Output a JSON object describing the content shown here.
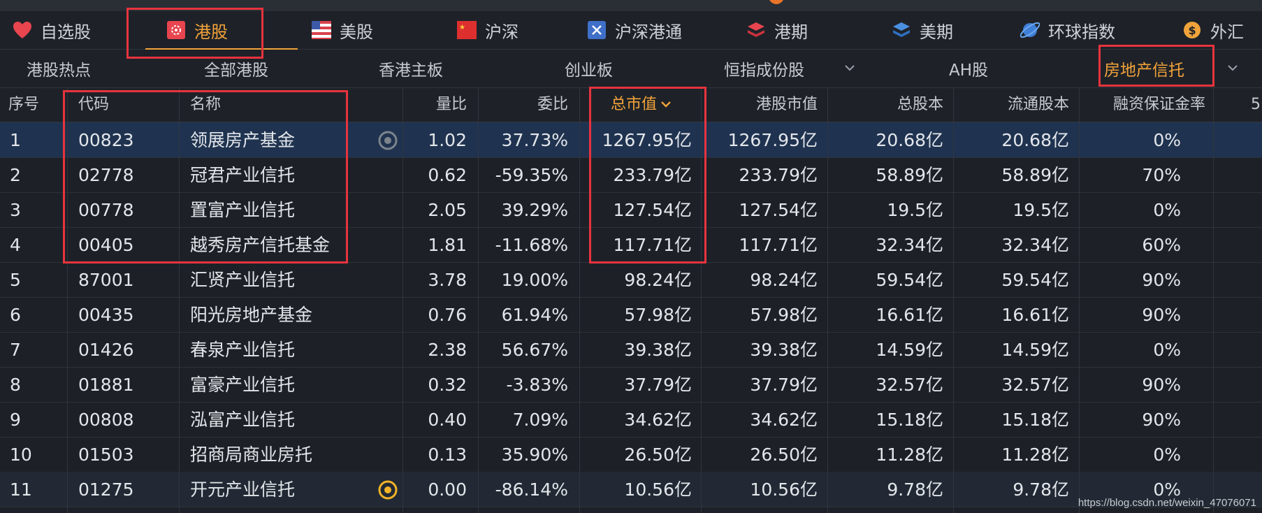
{
  "market_tabs": [
    {
      "label": "自选股",
      "icon": "heart-icon"
    },
    {
      "label": "港股",
      "icon": "hk-flag-icon",
      "active": true
    },
    {
      "label": "美股",
      "icon": "us-flag-icon"
    },
    {
      "label": "沪深",
      "icon": "cn-flag-icon"
    },
    {
      "label": "沪深港通",
      "icon": "connect-icon"
    },
    {
      "label": "港期",
      "icon": "stack-red-icon"
    },
    {
      "label": "美期",
      "icon": "stack-blue-icon"
    },
    {
      "label": "环球指数",
      "icon": "globe-icon"
    },
    {
      "label": "外汇",
      "icon": "dollar-coin-icon"
    }
  ],
  "sub_tabs": [
    {
      "label": "港股热点"
    },
    {
      "label": "全部港股"
    },
    {
      "label": "香港主板"
    },
    {
      "label": "创业板"
    },
    {
      "label": "恒指成份股"
    },
    {
      "label": "AH股"
    },
    {
      "label": "房地产信托",
      "active": true
    }
  ],
  "columns": {
    "seq": "序号",
    "code": "代码",
    "name": "名称",
    "vol_ratio": "量比",
    "bid_ratio": "委比",
    "total_mcap": "总市值",
    "hk_mcap": "港股市值",
    "total_shares": "总股本",
    "float_shares": "流通股本",
    "margin_rate": "融资保证金率",
    "next_partial": "5"
  },
  "sorted_column": "总市值",
  "sort_direction": "descending",
  "rows": [
    {
      "seq": "1",
      "code": "00823",
      "name": "领展房产基金",
      "vol_ratio": "1.02",
      "bid_ratio": "37.73%",
      "total_mcap": "1267.95亿",
      "hk_mcap": "1267.95亿",
      "total_shares": "20.68亿",
      "float_shares": "20.68亿",
      "margin_rate": "0%"
    },
    {
      "seq": "2",
      "code": "02778",
      "name": "冠君产业信托",
      "vol_ratio": "0.62",
      "bid_ratio": "-59.35%",
      "total_mcap": "233.79亿",
      "hk_mcap": "233.79亿",
      "total_shares": "58.89亿",
      "float_shares": "58.89亿",
      "margin_rate": "70%"
    },
    {
      "seq": "3",
      "code": "00778",
      "name": "置富产业信托",
      "vol_ratio": "2.05",
      "bid_ratio": "39.29%",
      "total_mcap": "127.54亿",
      "hk_mcap": "127.54亿",
      "total_shares": "19.5亿",
      "float_shares": "19.5亿",
      "margin_rate": "0%"
    },
    {
      "seq": "4",
      "code": "00405",
      "name": "越秀房产信托基金",
      "vol_ratio": "1.81",
      "bid_ratio": "-11.68%",
      "total_mcap": "117.71亿",
      "hk_mcap": "117.71亿",
      "total_shares": "32.34亿",
      "float_shares": "32.34亿",
      "margin_rate": "60%"
    },
    {
      "seq": "5",
      "code": "87001",
      "name": "汇贤产业信托",
      "vol_ratio": "3.78",
      "bid_ratio": "19.00%",
      "total_mcap": "98.24亿",
      "hk_mcap": "98.24亿",
      "total_shares": "59.54亿",
      "float_shares": "59.54亿",
      "margin_rate": "90%"
    },
    {
      "seq": "6",
      "code": "00435",
      "name": "阳光房地产基金",
      "vol_ratio": "0.76",
      "bid_ratio": "61.94%",
      "total_mcap": "57.98亿",
      "hk_mcap": "57.98亿",
      "total_shares": "16.61亿",
      "float_shares": "16.61亿",
      "margin_rate": "90%"
    },
    {
      "seq": "7",
      "code": "01426",
      "name": "春泉产业信托",
      "vol_ratio": "2.38",
      "bid_ratio": "56.67%",
      "total_mcap": "39.38亿",
      "hk_mcap": "39.38亿",
      "total_shares": "14.59亿",
      "float_shares": "14.59亿",
      "margin_rate": "0%"
    },
    {
      "seq": "8",
      "code": "01881",
      "name": "富豪产业信托",
      "vol_ratio": "0.32",
      "bid_ratio": "-3.83%",
      "total_mcap": "37.79亿",
      "hk_mcap": "37.79亿",
      "total_shares": "32.57亿",
      "float_shares": "32.57亿",
      "margin_rate": "90%"
    },
    {
      "seq": "9",
      "code": "00808",
      "name": "泓富产业信托",
      "vol_ratio": "0.40",
      "bid_ratio": "7.09%",
      "total_mcap": "34.62亿",
      "hk_mcap": "34.62亿",
      "total_shares": "15.18亿",
      "float_shares": "15.18亿",
      "margin_rate": "90%"
    },
    {
      "seq": "10",
      "code": "01503",
      "name": "招商局商业房托",
      "vol_ratio": "0.13",
      "bid_ratio": "35.90%",
      "total_mcap": "26.50亿",
      "hk_mcap": "26.50亿",
      "total_shares": "11.28亿",
      "float_shares": "11.28亿",
      "margin_rate": "0%"
    },
    {
      "seq": "11",
      "code": "01275",
      "name": "开元产业信托",
      "vol_ratio": "0.00",
      "bid_ratio": "-86.14%",
      "total_mcap": "10.56亿",
      "hk_mcap": "10.56亿",
      "total_shares": "9.78亿",
      "float_shares": "9.78亿",
      "margin_rate": "0%"
    }
  ],
  "watermark": "https://blog.csdn.net/weixin_47076071",
  "colors": {
    "accent": "#f2a23a",
    "highlight_box": "#e8333e",
    "selected_row": "#1f3350",
    "background": "#1d2127"
  }
}
